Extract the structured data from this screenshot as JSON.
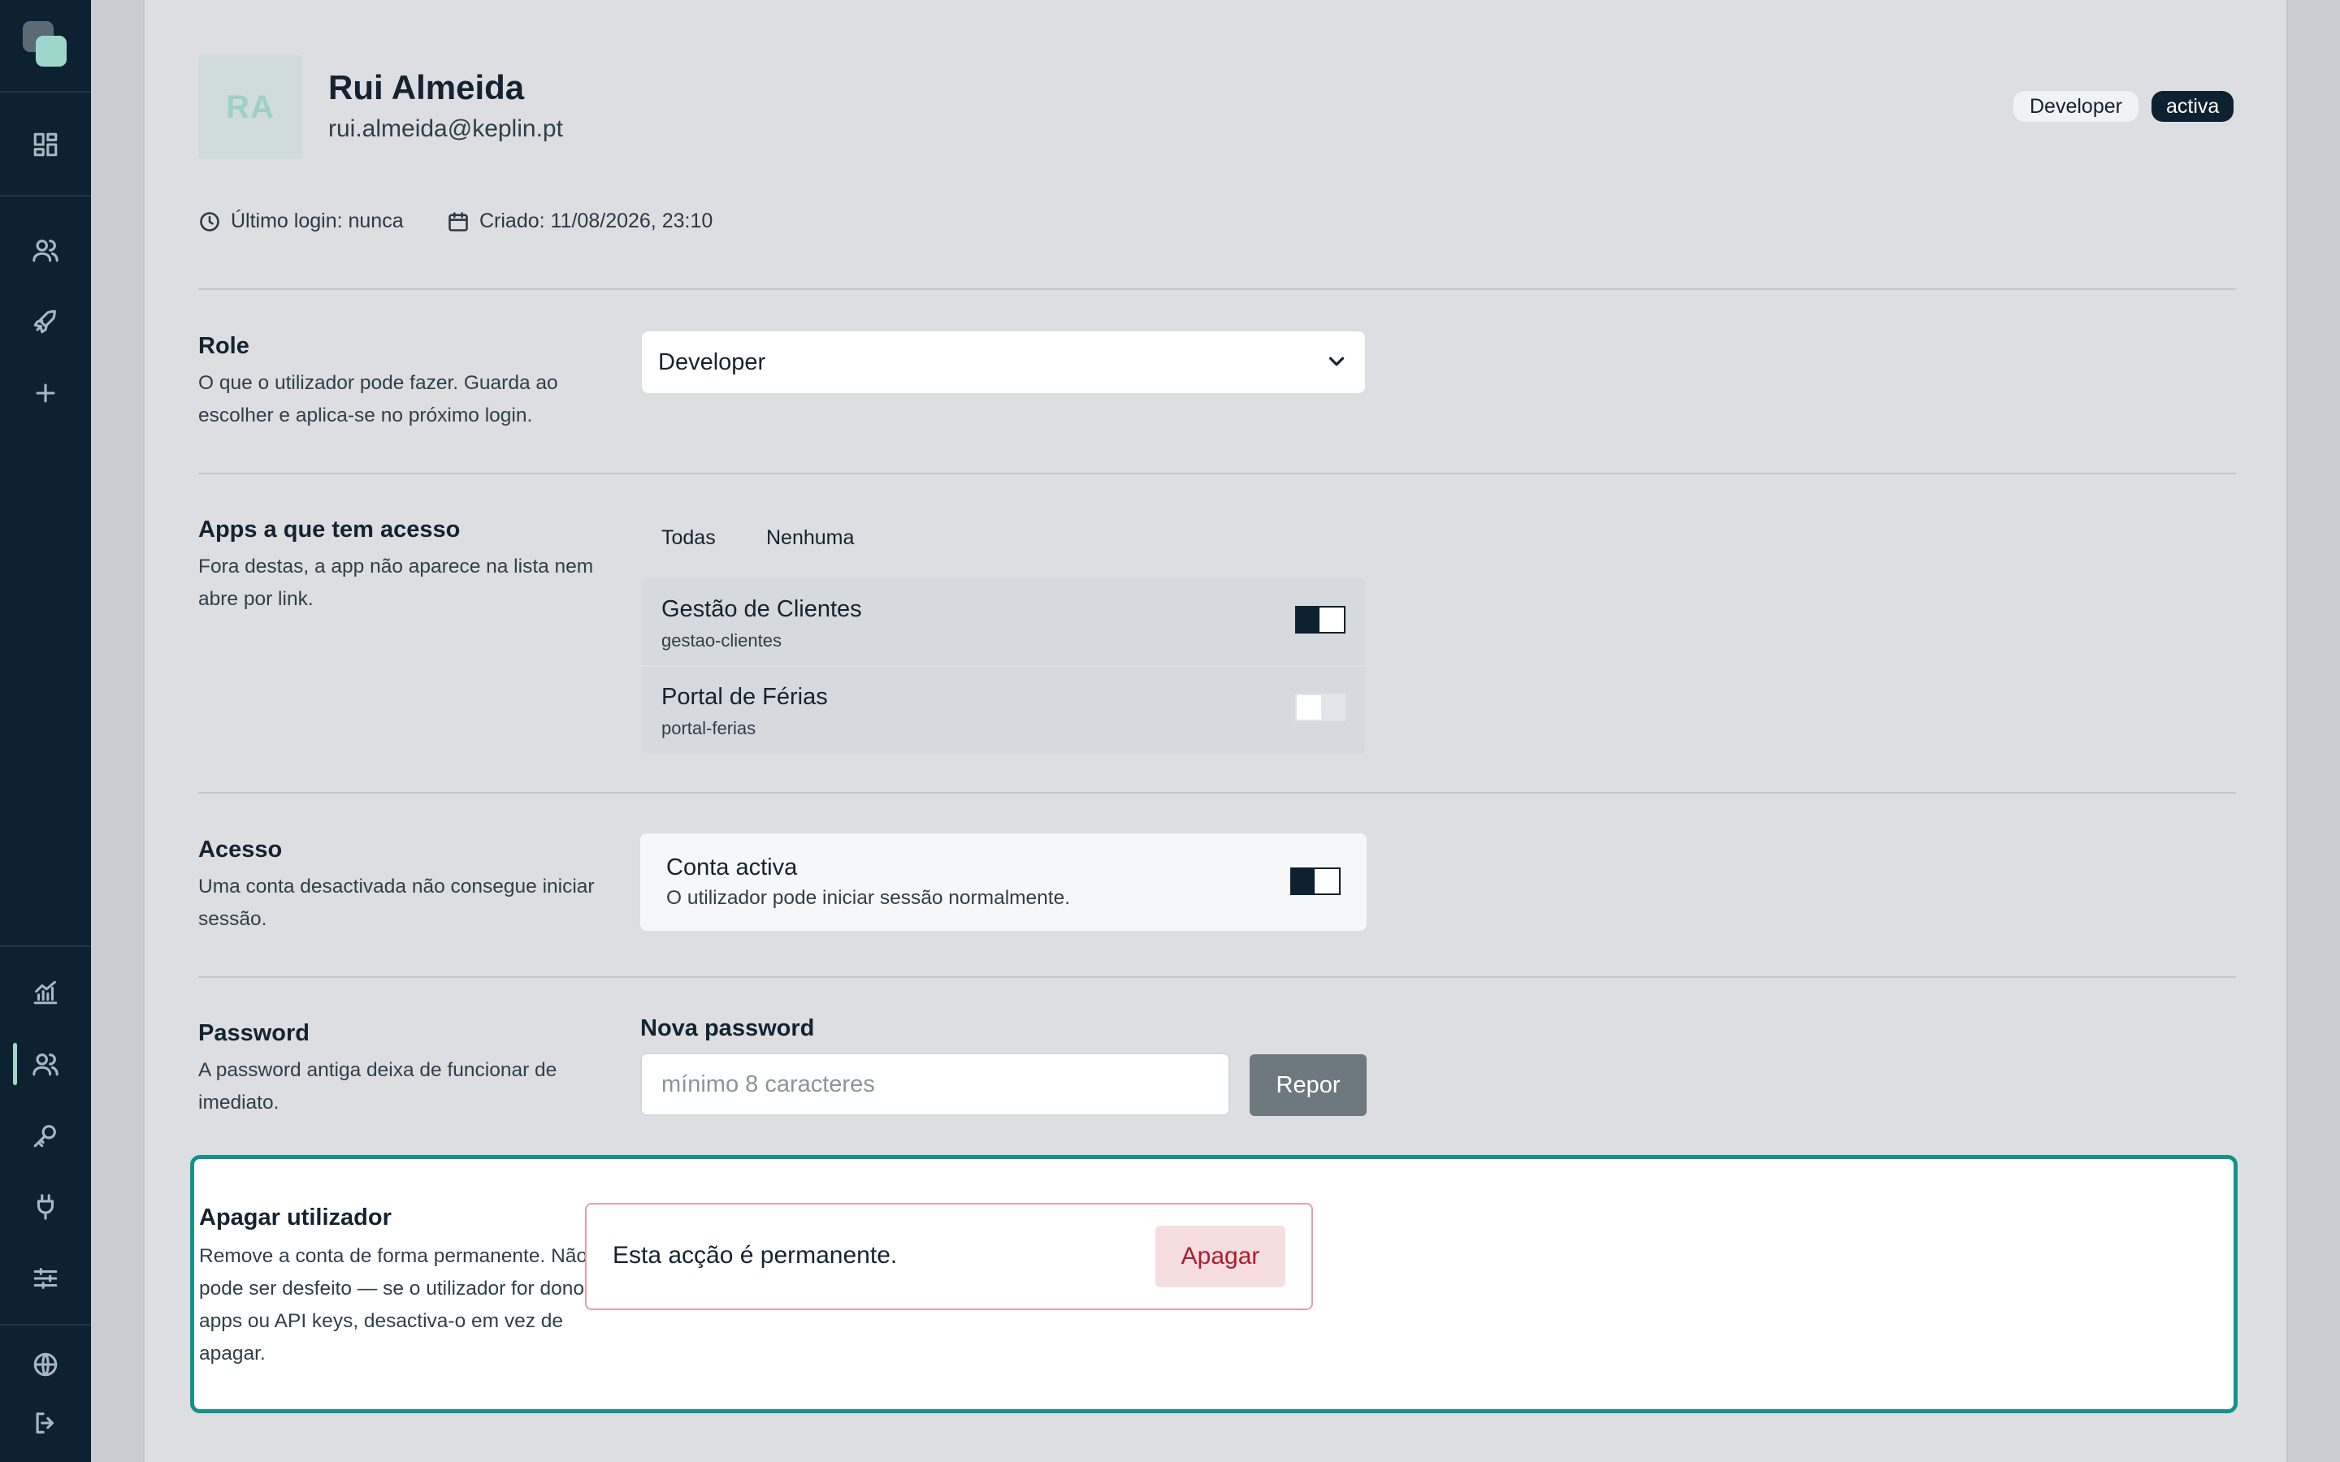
{
  "profile": {
    "initials": "RA",
    "name": "Rui Almeida",
    "email": "rui.almeida@keplin.pt",
    "role_badge": "Developer",
    "status_badge": "activa",
    "last_login": "Último login: nunca",
    "created": "Criado: 11/08/2026, 23:10"
  },
  "role": {
    "title": "Role",
    "description": "O que o utilizador pode fazer. Guarda ao escolher e aplica-se no próximo login.",
    "selected": "Developer"
  },
  "apps": {
    "title": "Apps a que tem acesso",
    "description": "Fora destas, a app não aparece na lista nem abre por link.",
    "select_all": "Todas",
    "select_none": "Nenhuma",
    "items": [
      {
        "name": "Gestão de Clientes",
        "slug": "gestao-clientes",
        "enabled": true
      },
      {
        "name": "Portal de Férias",
        "slug": "portal-ferias",
        "enabled": false
      }
    ]
  },
  "access": {
    "title": "Acesso",
    "description": "Uma conta desactivada não consegue iniciar sessão.",
    "toggle_title": "Conta activa",
    "toggle_subtitle": "O utilizador pode iniciar sessão normalmente.",
    "enabled": true
  },
  "password": {
    "title": "Password",
    "description": "A password antiga deixa de funcionar de imediato.",
    "field_label": "Nova password",
    "placeholder": "mínimo 8 caracteres",
    "value": "",
    "reset_label": "Repor"
  },
  "delete": {
    "title": "Apagar utilizador",
    "description": "Remove a conta de forma permanente. Não pode ser desfeito — se o utilizador for dono de apps ou API keys, desactiva-o em vez de apagar.",
    "warning": "Esta acção é permanente.",
    "button_label": "Apagar"
  },
  "colors": {
    "sidebar": "#0c2230",
    "accent": "#9fd6cc",
    "focus_border": "#14918a",
    "danger": "#b01c2c"
  },
  "sidebar_icons": [
    "logo",
    "dashboard-icon",
    "users-icon",
    "rocket-icon",
    "plus-icon",
    "chart-icon",
    "users-icon",
    "key-icon",
    "plug-icon",
    "sliders-icon",
    "globe-icon",
    "logout-icon"
  ]
}
